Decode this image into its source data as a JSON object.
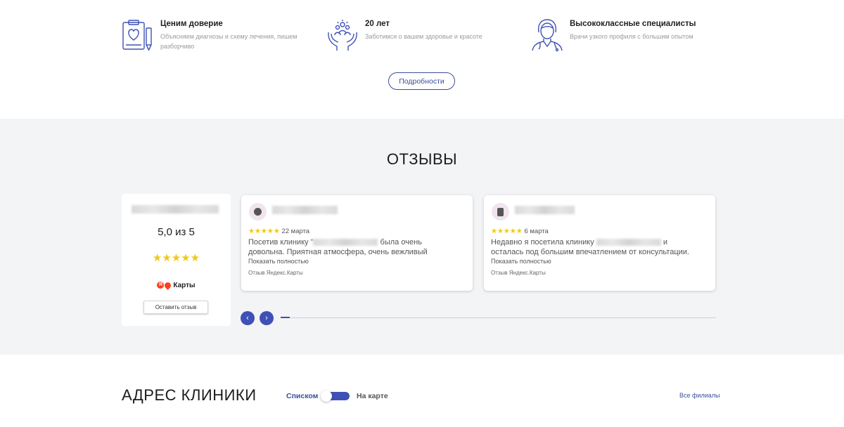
{
  "features": [
    {
      "icon": "clipboard-heart-icon",
      "title": "Ценим доверие",
      "desc_line1": "Объясняем диагнозы и схему лечения, пишем",
      "desc_line2": "разборчиво"
    },
    {
      "icon": "hands-people-icon",
      "title": "20 лет",
      "desc_line1": "Заботимся о вашем здоровье и красоте",
      "desc_line2": ""
    },
    {
      "icon": "doctor-icon",
      "title": "Высококлассные специалисты",
      "desc_line1": "Врачи узкого профиля с большим опытом",
      "desc_line2": ""
    }
  ],
  "more_button": "Подробности",
  "reviews": {
    "title": "ОТЗЫВЫ",
    "summary": {
      "rating_text": "5,0 из 5",
      "stars": "★★★★★",
      "rating_value": 5,
      "source_label": "Карты",
      "leave_review": "Оставить отзыв"
    },
    "cards": [
      {
        "stars": "★★★★★",
        "date": "22 марта",
        "text_pre": "Посетив клинику \"",
        "text_post": " была очень",
        "text_line2": "довольна. Приятная атмосфера, очень вежливый",
        "more": "Показать полностью",
        "source": "Отзыв Яндекс.Карты"
      },
      {
        "stars": "★★★★★",
        "date": "6 марта",
        "text_pre": "Недавно я посетила клинику ",
        "text_post": " и",
        "text_line2": "осталась под большим впечатлением от консультации.",
        "more": "Показать полностью",
        "source": "Отзыв Яндекс.Карты"
      }
    ],
    "prev_icon": "‹",
    "next_icon": "›"
  },
  "address": {
    "title": "АДРЕС КЛИНИКИ",
    "toggle_list": "Списком",
    "toggle_map": "На карте",
    "all_branches": "Все филиалы"
  },
  "colors": {
    "accent": "#3f51b5",
    "star": "#f2c80f",
    "section_bg": "#f3f4f6"
  }
}
